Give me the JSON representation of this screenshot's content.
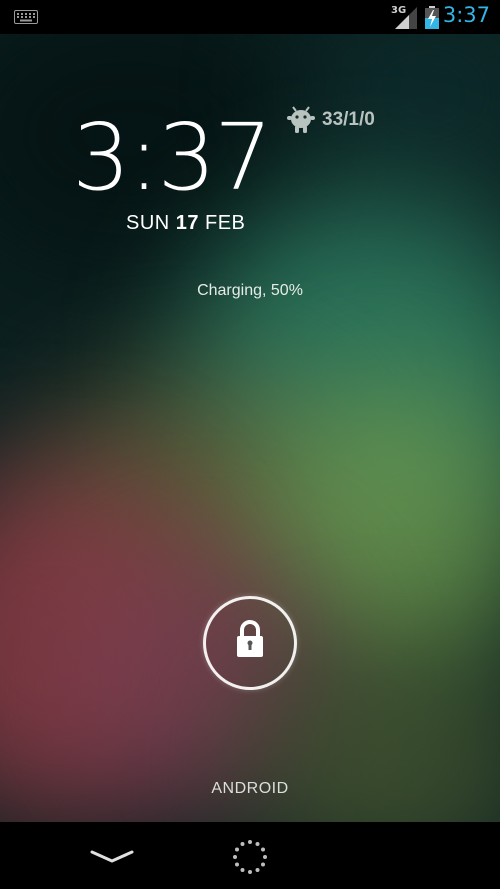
{
  "status_bar": {
    "network_type": "3G",
    "time": "3:37",
    "icons": [
      "keyboard-icon",
      "signal-icon",
      "battery-charging-icon"
    ]
  },
  "lockscreen": {
    "clock": "3:37",
    "date": {
      "day": "SUN",
      "day_number": "17",
      "month": "FEB"
    },
    "widget": {
      "icon": "android-bot-icon",
      "text": "33/1/0"
    },
    "charging_text": "Charging, 50%",
    "unlock_icon": "lock-icon",
    "carrier_label": "ANDROID"
  },
  "nav_bar": {
    "icons": [
      "back-chevron-icon",
      "assist-ring-icon"
    ]
  },
  "colors": {
    "status_time": "#33b5e5",
    "text": "#ffffff",
    "widget_text": "#b8c2bf"
  }
}
